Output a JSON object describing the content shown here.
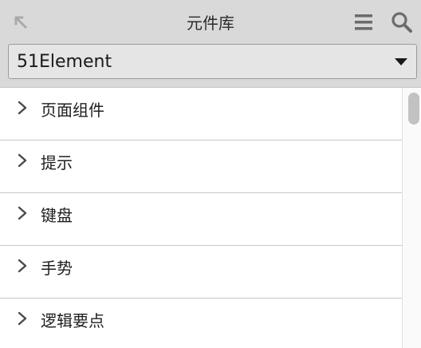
{
  "header": {
    "title": "元件库",
    "icons": {
      "back": "collapse-arrow-icon",
      "menu": "hamburger-menu-icon",
      "search": "search-icon"
    }
  },
  "library_select": {
    "selected": "51Element"
  },
  "list": {
    "items": [
      {
        "label": "页面组件"
      },
      {
        "label": "提示"
      },
      {
        "label": "键盘"
      },
      {
        "label": "手势"
      },
      {
        "label": "逻辑要点"
      }
    ]
  },
  "colors": {
    "header_bg": "#d9d9d9",
    "select_bg": "#e5e5e5",
    "divider": "#c8c8c8",
    "scroll_thumb": "#c2c2c2"
  }
}
